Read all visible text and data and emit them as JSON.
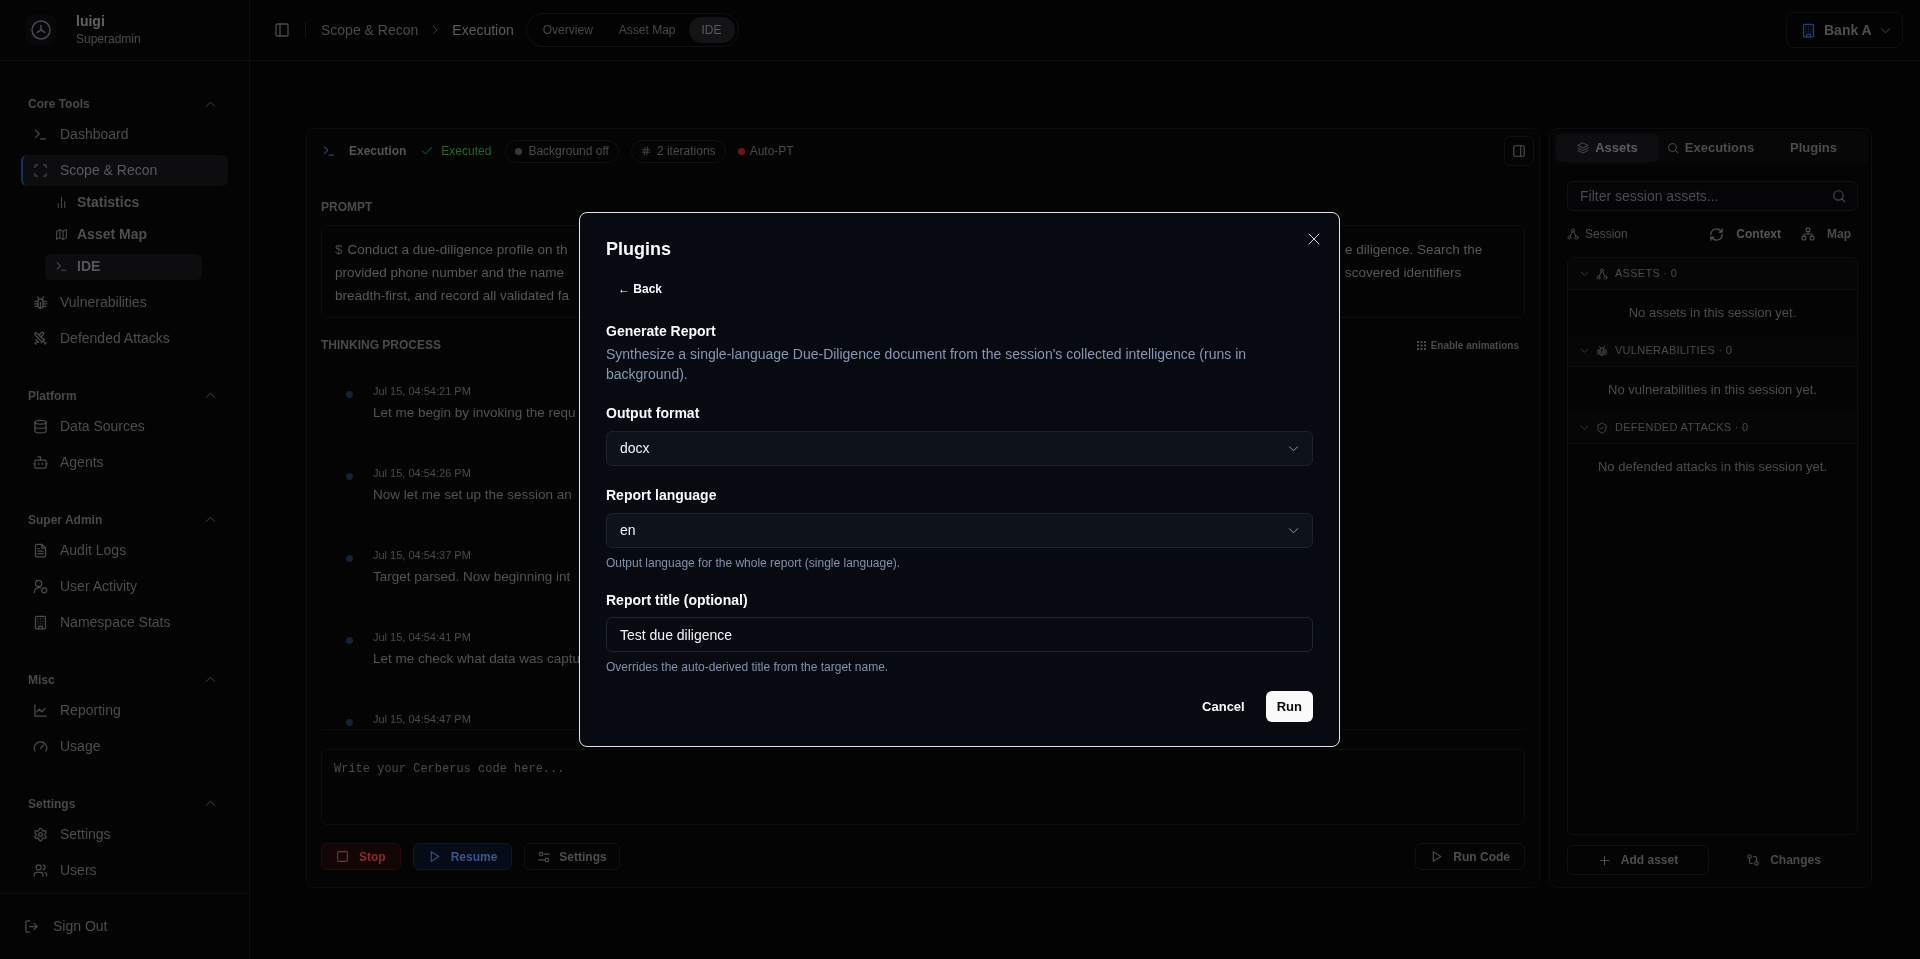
{
  "sidebar": {
    "user": {
      "name": "luigi",
      "role": "Superadmin"
    },
    "sections": [
      {
        "title": "Core Tools",
        "expanded": true,
        "items": [
          {
            "label": "Dashboard",
            "selected": false
          },
          {
            "label": "Scope & Recon",
            "selected": true,
            "children": [
              {
                "label": "Statistics",
                "selected": false
              },
              {
                "label": "Asset Map",
                "selected": false
              },
              {
                "label": "IDE",
                "selected": true
              }
            ]
          },
          {
            "label": "Vulnerabilities",
            "selected": false
          },
          {
            "label": "Defended Attacks",
            "selected": false
          }
        ]
      },
      {
        "title": "Platform",
        "expanded": true,
        "items": [
          {
            "label": "Data Sources",
            "selected": false
          },
          {
            "label": "Agents",
            "selected": false
          }
        ]
      },
      {
        "title": "Super Admin",
        "expanded": true,
        "items": [
          {
            "label": "Audit Logs",
            "selected": false
          },
          {
            "label": "User Activity",
            "selected": false
          },
          {
            "label": "Namespace Stats",
            "selected": false
          }
        ]
      },
      {
        "title": "Misc",
        "expanded": true,
        "items": [
          {
            "label": "Reporting",
            "selected": false
          },
          {
            "label": "Usage",
            "selected": false
          }
        ]
      },
      {
        "title": "Settings",
        "expanded": true,
        "items": [
          {
            "label": "Settings",
            "selected": false
          },
          {
            "label": "Users",
            "selected": false
          }
        ]
      }
    ],
    "sign_out": "Sign Out"
  },
  "top_bar": {
    "breadcrumb": [
      "Scope & Recon",
      "Execution"
    ],
    "view_tabs": [
      {
        "label": "Overview",
        "selected": false
      },
      {
        "label": "Asset Map",
        "selected": false
      },
      {
        "label": "IDE",
        "selected": true
      }
    ],
    "workspace": "Bank A"
  },
  "execution": {
    "title": "Execution",
    "status": "Executed",
    "badges": [
      {
        "kind": "status",
        "label": "Background off",
        "color": "#38383b"
      },
      {
        "kind": "count",
        "label": "2 iterations"
      },
      {
        "kind": "flag",
        "label": "Auto-PT",
        "color": "#6b1616"
      }
    ],
    "prompt": {
      "label": "PROMPT",
      "symbol": "$",
      "lines": [
        {
          "left": "Conduct a due-diligence profile on th",
          "right": "e diligence. Search the"
        },
        {
          "left": "provided phone number and the name",
          "right": "scovered identifiers"
        },
        {
          "left": "breadth-first, and record all validated fa"
        }
      ]
    },
    "thinking": {
      "label": "THINKING PROCESS",
      "toggle": "Enable animations",
      "steps": [
        {
          "time": "Jul 15, 04:54:21 PM",
          "text": "Let me begin by invoking the requ"
        },
        {
          "time": "Jul 15, 04:54:26 PM",
          "text": "Now let me set up the session an"
        },
        {
          "time": "Jul 15, 04:54:37 PM",
          "text": "Target parsed. Now beginning int"
        },
        {
          "time": "Jul 15, 04:54:41 PM",
          "text": "Let me check what data was captu"
        },
        {
          "time": "Jul 15, 04:54:47 PM"
        }
      ]
    },
    "editor": {
      "placeholder": "Write your Cerberus code here...",
      "actions": [
        {
          "kind": "stop",
          "label": "Stop"
        },
        {
          "kind": "resume",
          "label": "Resume"
        },
        {
          "kind": "settings",
          "label": "Settings"
        }
      ],
      "run": "Run Code"
    }
  },
  "assets_panel": {
    "tabs": [
      {
        "label": "Assets",
        "selected": true
      },
      {
        "label": "Executions",
        "selected": false
      },
      {
        "label": "Plugins",
        "selected": false
      }
    ],
    "filter": {
      "placeholder": "Filter session assets..."
    },
    "scope": {
      "session": "Session",
      "context": "Context",
      "map": "Map"
    },
    "sections": [
      {
        "title": "ASSETS · 0",
        "expanded": true,
        "empty": "No assets in this session yet."
      },
      {
        "title": "VULNERABILITIES · 0",
        "expanded": true,
        "empty": "No vulnerabilities in this session yet."
      },
      {
        "title": "DEFENDED ATTACKS · 0",
        "expanded": true,
        "empty": "No defended attacks in this session yet."
      }
    ],
    "add": "Add asset",
    "changes": "Changes"
  },
  "dialog": {
    "title": "Plugins",
    "back": "← Back",
    "plugin": {
      "name": "Generate Report",
      "description": "Synthesize a single-language Due-Diligence document from the session's collected intelligence (runs in background)."
    },
    "fields": [
      {
        "kind": "select",
        "label": "Output format",
        "value": "docx"
      },
      {
        "kind": "select",
        "label": "Report language",
        "value": "en",
        "help": "Output language for the whole report (single language)."
      },
      {
        "kind": "text",
        "label": "Report title (optional)",
        "value": "Test due diligence",
        "help": "Overrides the auto-derived title from the target name."
      }
    ],
    "buttons": [
      {
        "kind": "ghost",
        "label": "Cancel"
      },
      {
        "kind": "primary",
        "label": "Run"
      }
    ]
  }
}
